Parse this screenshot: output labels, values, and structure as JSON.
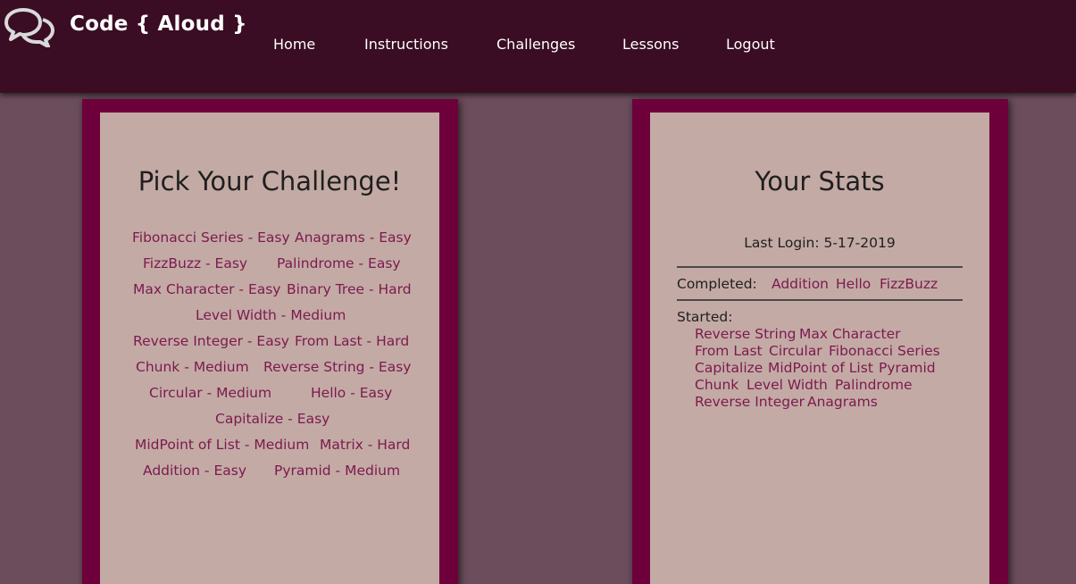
{
  "header": {
    "brand": "Code { Aloud }",
    "logo_icon": "chat-bubbles-icon",
    "nav": [
      {
        "label": "Home"
      },
      {
        "label": "Instructions"
      },
      {
        "label": "Challenges"
      },
      {
        "label": "Lessons"
      },
      {
        "label": "Logout"
      }
    ]
  },
  "challenges": {
    "title": "Pick Your Challenge!",
    "items": [
      "Fibonacci Series - Easy",
      "Anagrams - Easy",
      "FizzBuzz - Easy",
      "Palindrome - Easy",
      "Max Character - Easy",
      "Binary Tree - Hard",
      "Level Width - Medium",
      "Reverse Integer - Easy",
      "From Last - Hard",
      "Chunk - Medium",
      "Reverse String - Easy",
      "Circular - Medium",
      "Hello - Easy",
      "Capitalize - Easy",
      "MidPoint of List - Medium",
      "Matrix - Hard",
      "Addition - Easy",
      "Pyramid - Medium"
    ]
  },
  "stats": {
    "title": "Your Stats",
    "last_login": "Last Login: 5-17-2019",
    "completed_label": "Completed:",
    "completed": [
      "Addition",
      "Hello",
      "FizzBuzz"
    ],
    "started_label": "Started:",
    "started": [
      "Reverse String",
      "Max Character",
      "From Last",
      "Circular",
      "Fibonacci Series",
      "Capitalize",
      "MidPoint of List",
      "Pyramid",
      "Chunk",
      "Level Width",
      "Palindrome",
      "Reverse Integer",
      "Anagrams"
    ]
  },
  "colors": {
    "background": "#6b4d5c",
    "header": "#3a0d24",
    "panel_frame": "#6d003a",
    "panel_card": "#c4aaa5",
    "link": "#7b1a4e"
  }
}
